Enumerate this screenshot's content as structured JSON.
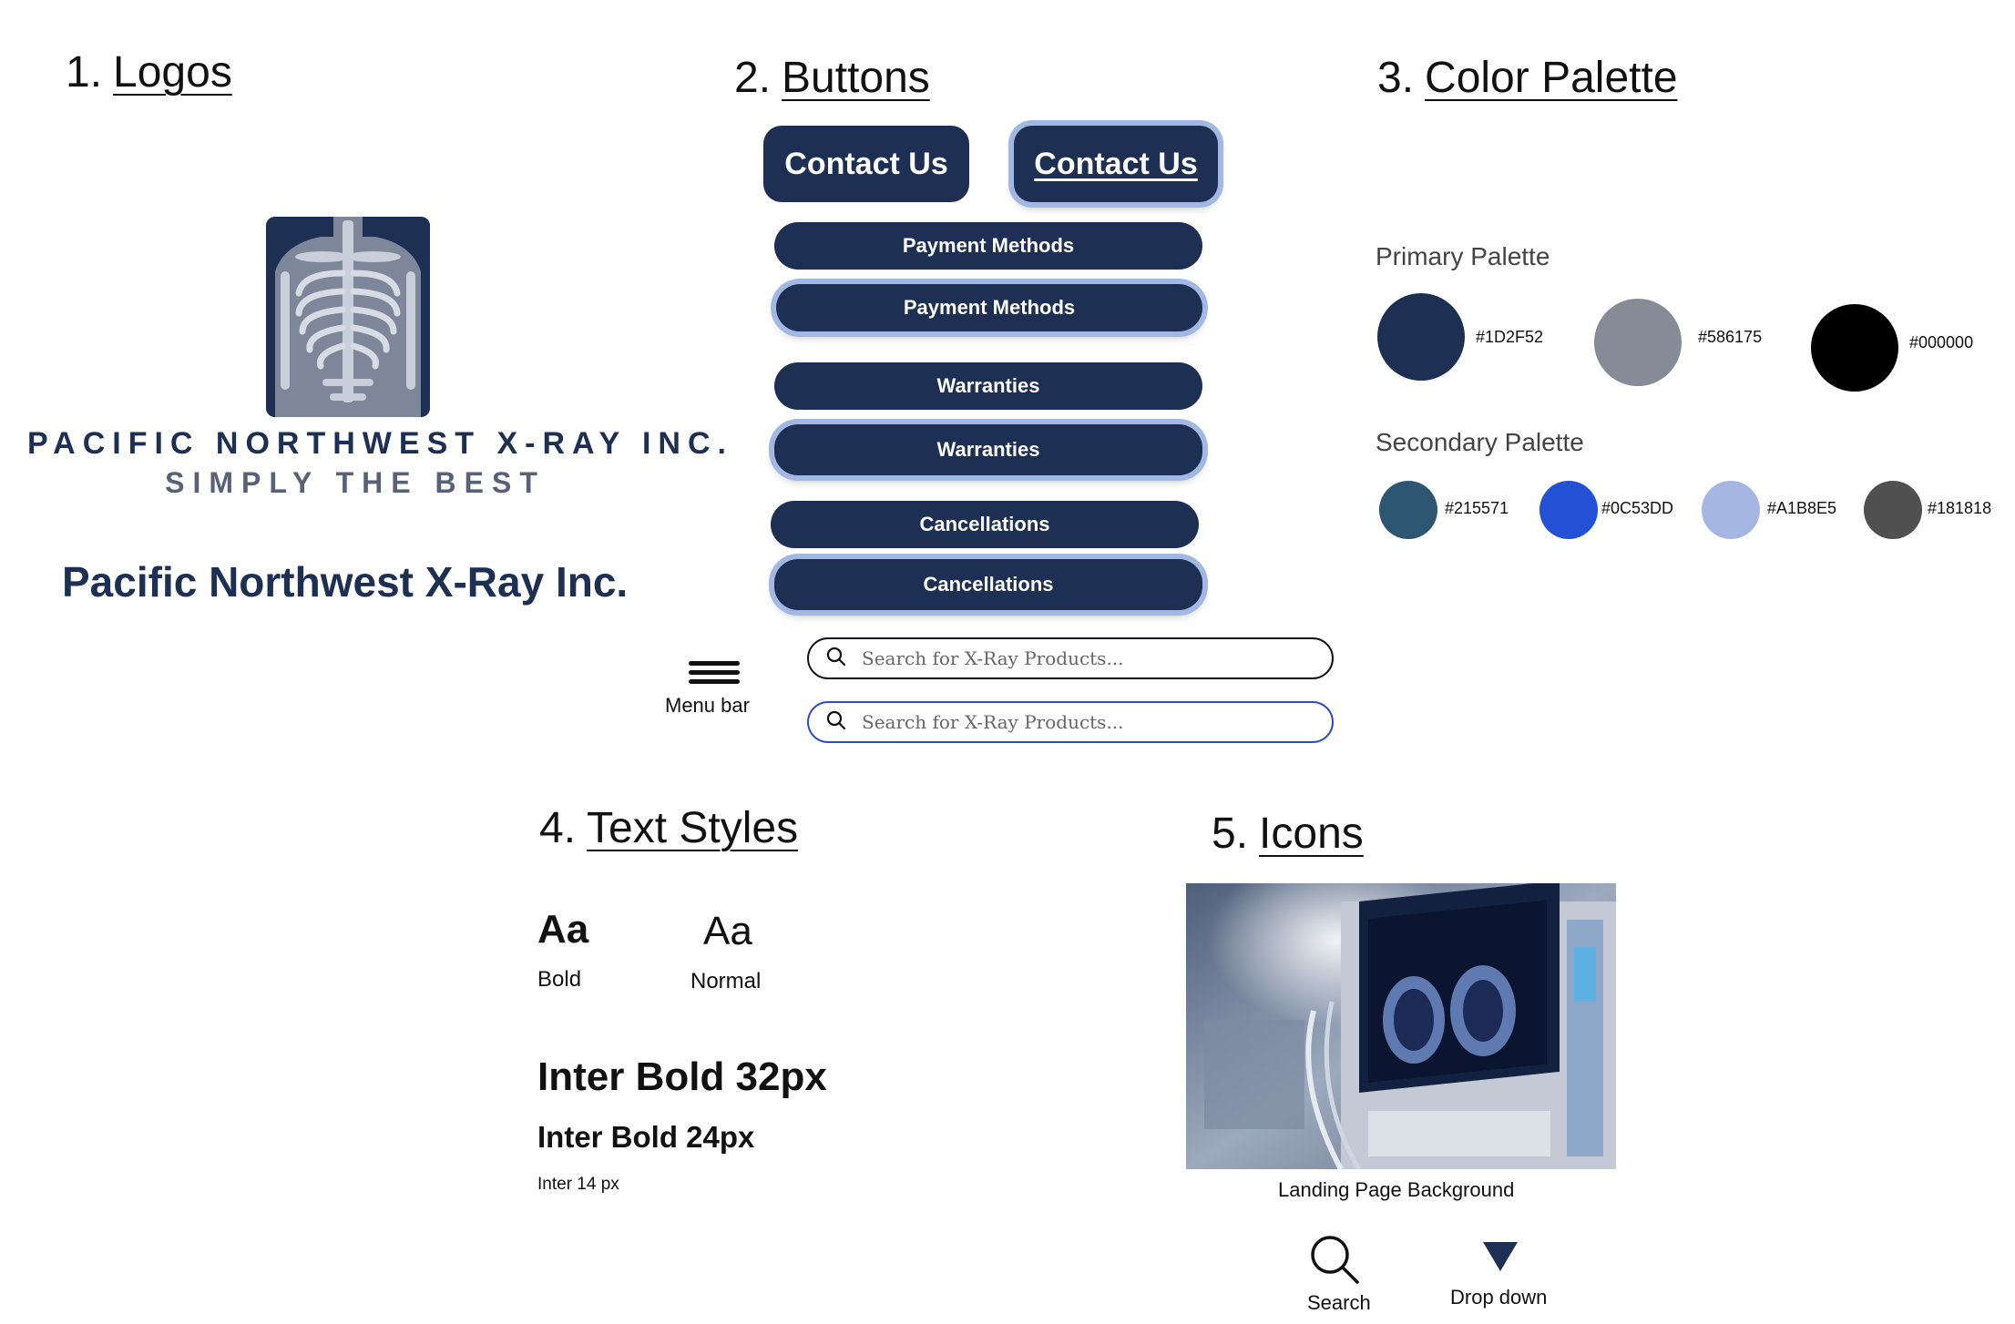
{
  "sections": {
    "logos": {
      "num": "1.",
      "label": "Logos"
    },
    "buttons": {
      "num": "2.",
      "label": "Buttons"
    },
    "colors": {
      "num": "3.",
      "label": "Color Palette"
    },
    "text": {
      "num": "4.",
      "label": "Text Styles"
    },
    "icons": {
      "num": "5.",
      "label": "Icons"
    }
  },
  "logo": {
    "line1": "PACIFIC NORTHWEST X-RAY INC.",
    "line2": "SIMPLY THE BEST",
    "wordmark": "Pacific Northwest X-Ray Inc."
  },
  "buttons": {
    "contact_default": "Contact Us",
    "contact_hover": "Contact Us",
    "payment_default": "Payment Methods",
    "payment_hover": "Payment Methods",
    "warranties_default": "Warranties",
    "warranties_hover": "Warranties",
    "cancellations_default": "Cancellations",
    "cancellations_hover": "Cancellations"
  },
  "menu": {
    "label": "Menu bar",
    "icon": "hamburger-icon"
  },
  "search": {
    "placeholder_default": "Search for X-Ray Products...",
    "placeholder_focus": "Search for X-Ray Products...",
    "icon": "search-icon",
    "focus_border": "#2C4BC9"
  },
  "palette": {
    "primary_title": "Primary Palette",
    "primary": [
      {
        "hex": "#1D2F52",
        "color": "#1D2F52"
      },
      {
        "hex": "#586175",
        "color": "#868B98"
      },
      {
        "hex": "#000000",
        "color": "#000000"
      }
    ],
    "secondary_title": "Secondary Palette",
    "secondary": [
      {
        "hex": "#215571",
        "color": "#2E5673"
      },
      {
        "hex": "#0C53DD",
        "color": "#2251D6"
      },
      {
        "hex": "#A1B8E5",
        "color": "#A5B6E3"
      },
      {
        "hex": "#181818",
        "color": "#505050"
      }
    ]
  },
  "text_styles": {
    "bold_sample": "Aa",
    "bold_label": "Bold",
    "normal_sample": "Aa",
    "normal_label": "Normal",
    "h32": "Inter Bold 32px",
    "h24": "Inter Bold 24px",
    "body14": "Inter 14 px"
  },
  "icons": {
    "photo_caption": "Landing Page Background",
    "search_label": "Search",
    "dropdown_label": "Drop down"
  }
}
